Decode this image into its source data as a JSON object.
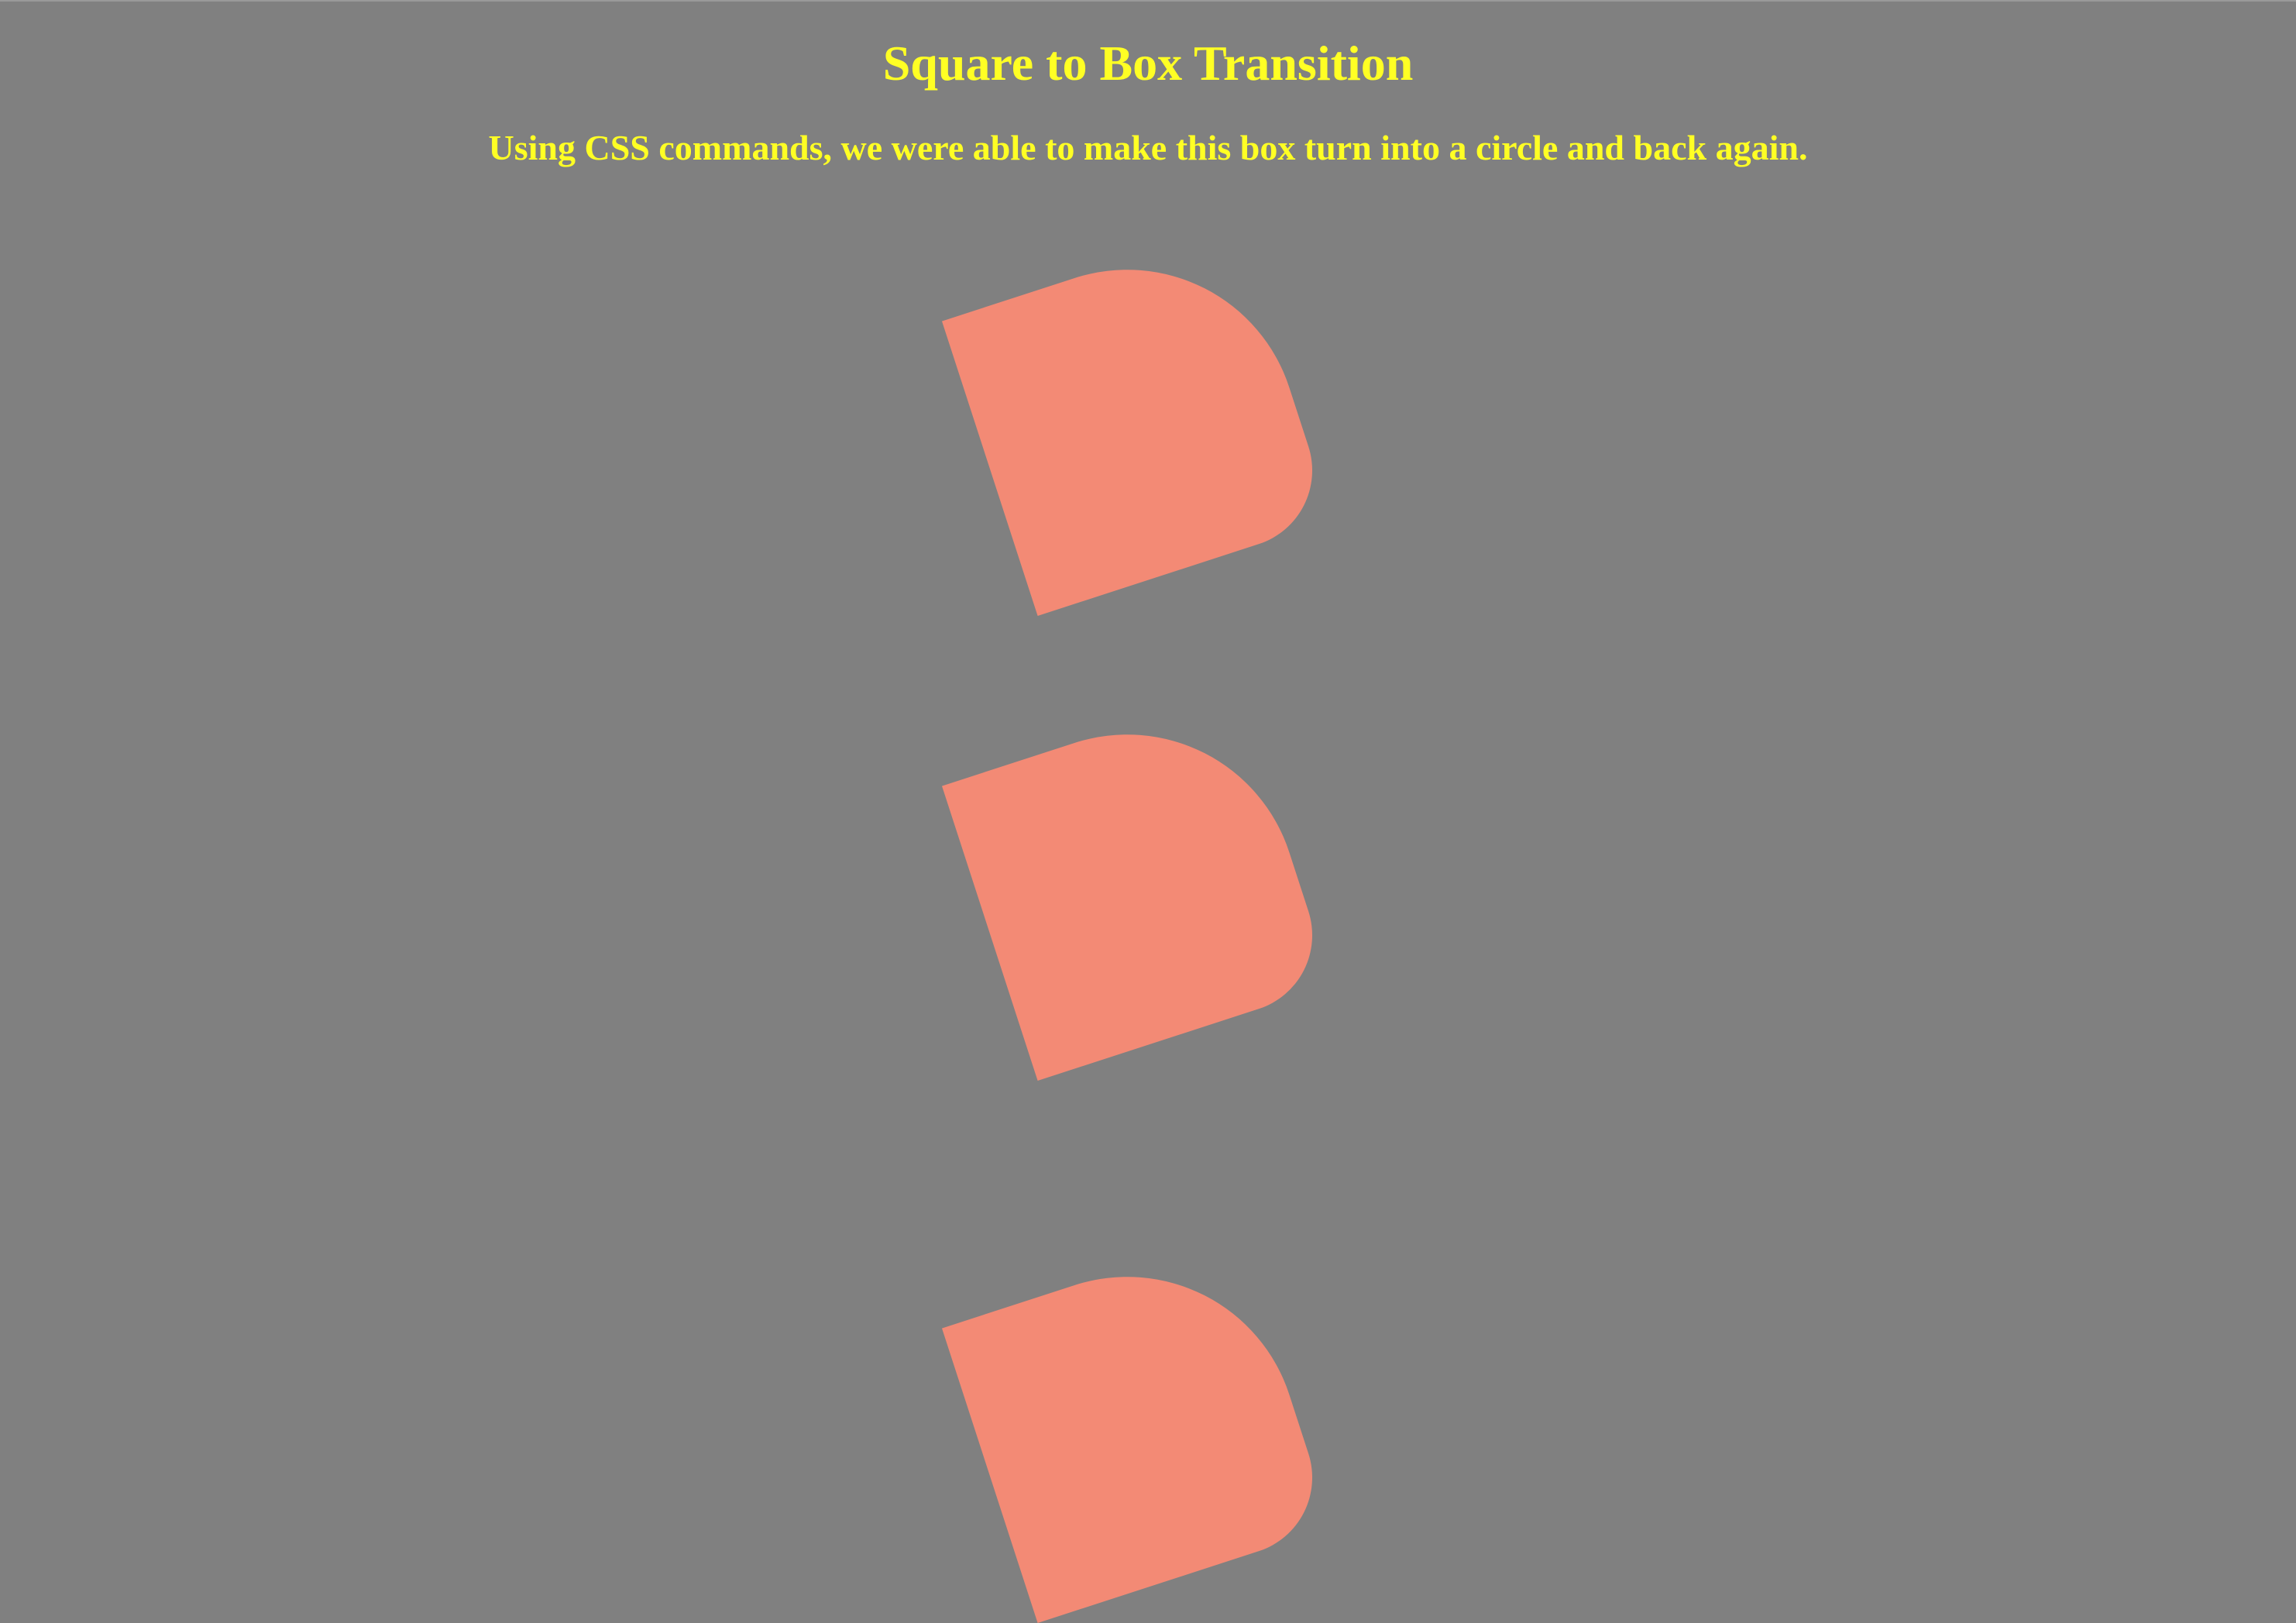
{
  "page": {
    "title": "Square to Box Transition",
    "subtitle": "Using CSS commands, we were able to make this box turn into a circle and back again.",
    "colors": {
      "background": "#808080",
      "text": "#ffff24",
      "shape": "#f38a75"
    }
  }
}
